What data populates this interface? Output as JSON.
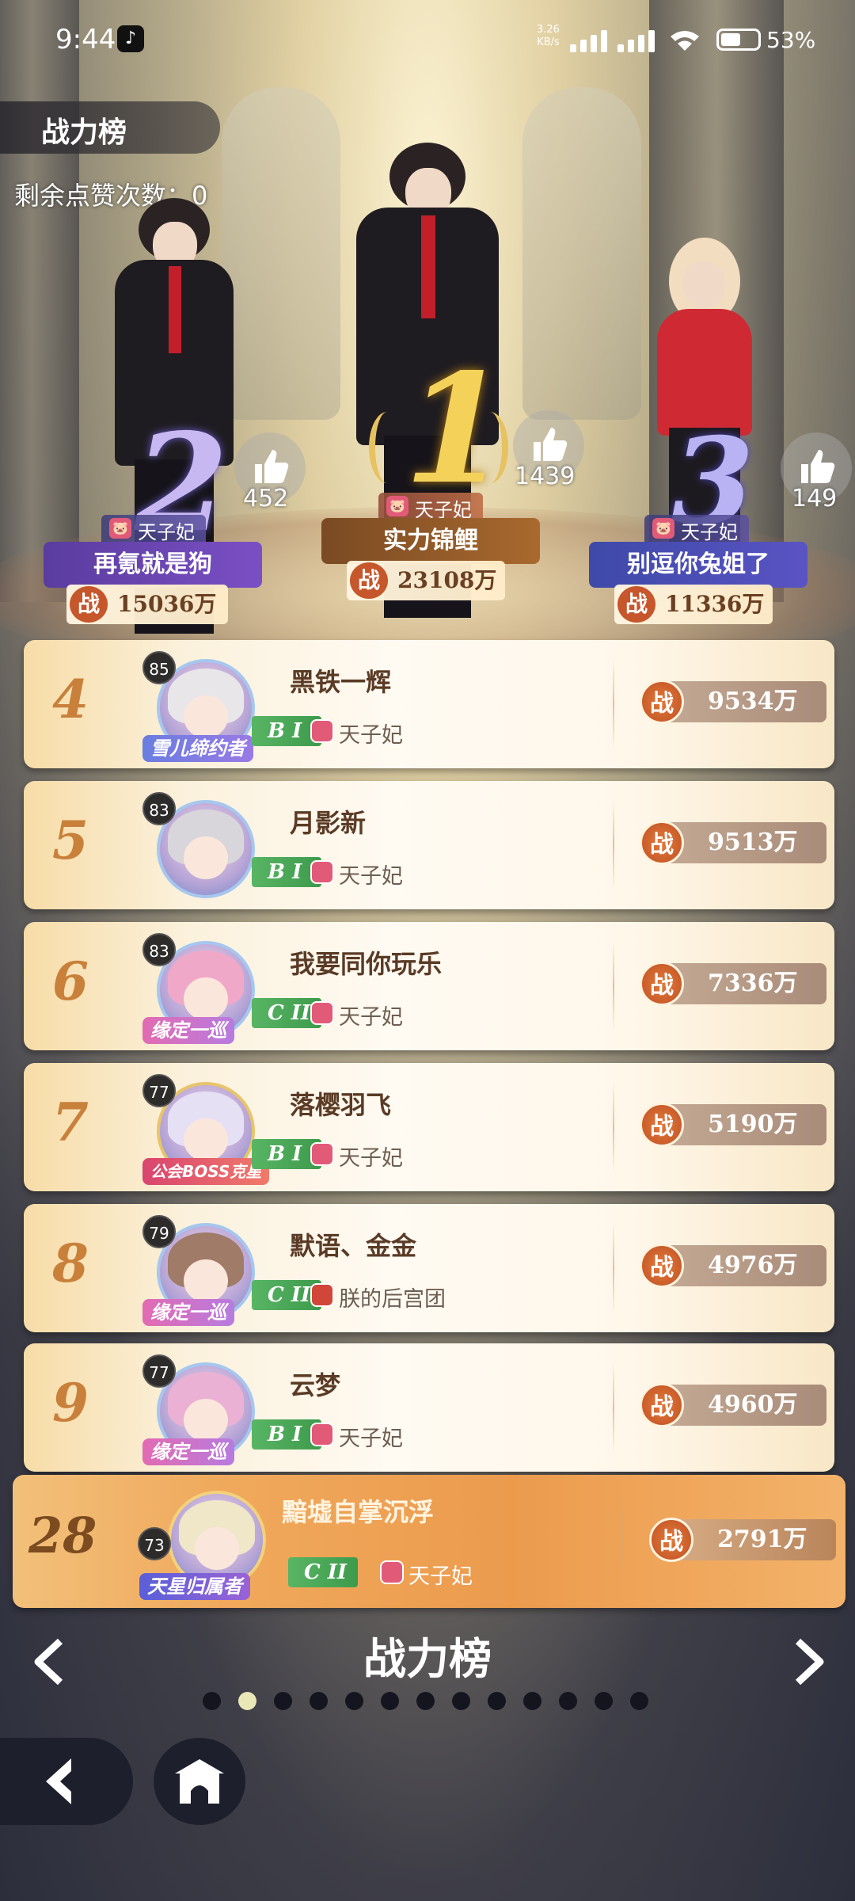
{
  "status_bar": {
    "time": "9:44",
    "app_icon": "tiktok-icon",
    "speed_value": "3.26",
    "speed_unit": "KB/s",
    "battery": "53%"
  },
  "header": {
    "title": "战力榜",
    "likes_label": "剩余点赞次数：",
    "likes_value": "0"
  },
  "podium": [
    {
      "rank": "2",
      "guild": "天子妃",
      "name": "再氪就是狗",
      "power_prefix": "战",
      "power": "15036万",
      "likes": "452"
    },
    {
      "rank": "1",
      "guild": "天子妃",
      "name": "实力锦鲤",
      "power_prefix": "战",
      "power": "23108万",
      "likes": "1439"
    },
    {
      "rank": "3",
      "guild": "天子妃",
      "name": "别逗你兔姐了",
      "power_prefix": "战",
      "power": "11336万",
      "likes": "149"
    }
  ],
  "rows": [
    {
      "rank": "4",
      "level": "85",
      "name": "黑铁一辉",
      "grade": "B I",
      "guild": "天子妃",
      "power": "9534万",
      "title_ribbon": "雪儿缔约者"
    },
    {
      "rank": "5",
      "level": "83",
      "name": "月影新",
      "grade": "B I",
      "guild": "天子妃",
      "power": "9513万",
      "title_ribbon": ""
    },
    {
      "rank": "6",
      "level": "83",
      "name": "我要同你玩乐",
      "grade": "C II",
      "guild": "天子妃",
      "power": "7336万",
      "title_ribbon": "缘定一巡"
    },
    {
      "rank": "7",
      "level": "77",
      "name": "落樱羽飞",
      "grade": "B I",
      "guild": "天子妃",
      "power": "5190万",
      "title_ribbon": "公会BOSS克星"
    },
    {
      "rank": "8",
      "level": "79",
      "name": "默语、金金",
      "grade": "C II",
      "guild": "朕的后宫团",
      "power": "4976万",
      "title_ribbon": "缘定一巡"
    },
    {
      "rank": "9",
      "level": "77",
      "name": "云梦",
      "grade": "B I",
      "guild": "天子妃",
      "power": "4960万",
      "title_ribbon": "缘定一巡"
    }
  ],
  "me": {
    "rank": "28",
    "level": "73",
    "name": "黯墟自掌沉浮",
    "grade": "C II",
    "guild": "天子妃",
    "power": "2791万",
    "title_ribbon": "天星归属者"
  },
  "power_prefix": "战",
  "footer": {
    "board_title": "战力榜",
    "page_dots": 13,
    "active_dot": 1
  }
}
